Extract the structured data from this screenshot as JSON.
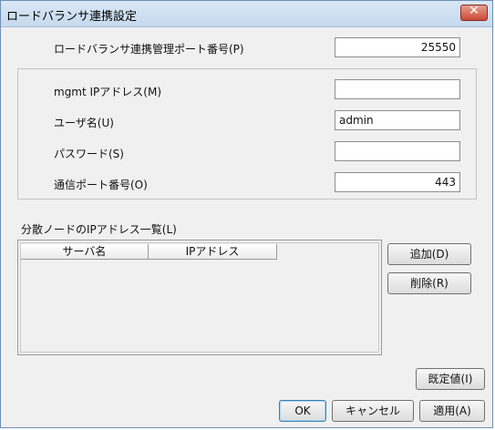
{
  "window": {
    "title": "ロードバランサ連携設定",
    "close_glyph": "✕"
  },
  "fields": {
    "lb_port": {
      "label": "ロードバランサ連携管理ポート番号(P)",
      "value": "25550"
    },
    "mgmt_ip": {
      "label": "mgmt IPアドレス(M)",
      "value": ""
    },
    "username": {
      "label": "ユーザ名(U)",
      "value": "admin"
    },
    "password": {
      "label": "パスワード(S)",
      "value": ""
    },
    "comm_port": {
      "label": "通信ポート番号(O)",
      "value": "443"
    }
  },
  "node_list": {
    "label": "分散ノードのIPアドレス一覧(L)",
    "columns": [
      "サーバ名",
      "IPアドレス"
    ],
    "rows": []
  },
  "buttons": {
    "add": "追加(D)",
    "delete": "削除(R)",
    "default_values": "既定値(I)",
    "ok": "OK",
    "cancel": "キャンセル",
    "apply": "適用(A)"
  },
  "icons": {
    "close": "close-icon"
  },
  "colors": {
    "titlebar": "#c6d9ee",
    "close_button": "#c94a36",
    "dialog_bg": "#f0f0f0"
  }
}
